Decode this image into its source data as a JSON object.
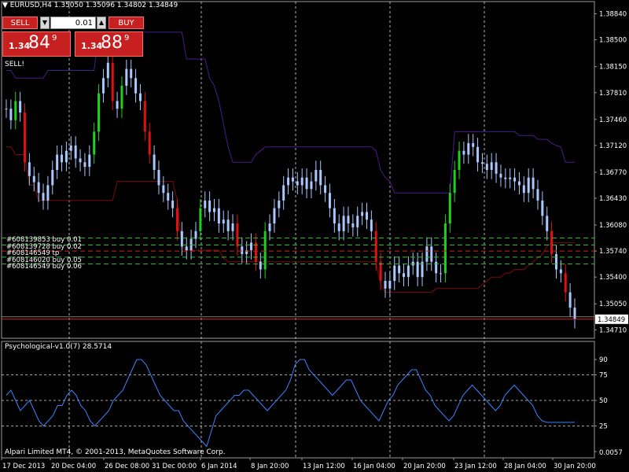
{
  "chart_header": {
    "symbol_line": "EURUSD,H4  1.35050 1.35096 1.34802 1.34849",
    "signal_text": "SELL!"
  },
  "one_click": {
    "sell_label": "SELL",
    "buy_label": "BUY",
    "lot_value": "0.01",
    "sell_prefix": "1.34",
    "sell_big": "84",
    "sell_super": "9",
    "buy_prefix": "1.34",
    "buy_big": "88",
    "buy_super": "9"
  },
  "orders": [
    "#608139853 buy 0.01",
    "#608139728 buy 0.02",
    "#608146549 tp",
    "#608146020 buy 0.05",
    "#608146549 buy 0.06"
  ],
  "current_price_label": "1.34849",
  "oscillator": {
    "title": "Psychological-v1.0(7) 28.5714",
    "levels": [
      "90",
      "75",
      "50",
      "25",
      "0.0057"
    ]
  },
  "copyright": "Alpari Limited MT4, © 2001-2013, MetaQuotes Software Corp.",
  "price_axis": [
    "1.38840",
    "1.38500",
    "1.38150",
    "1.37810",
    "1.37460",
    "1.37120",
    "1.36770",
    "1.36430",
    "1.36080",
    "1.35740",
    "1.35400",
    "1.35050",
    "1.34710"
  ],
  "time_axis": [
    "17 Dec 2013",
    "20 Dec 04:00",
    "26 Dec 08:00",
    "31 Dec 00:00",
    "6 Jan 2014",
    "8 Jan 20:00",
    "13 Jan 12:00",
    "16 Jan 04:00",
    "20 Jan 20:00",
    "23 Jan 12:00",
    "28 Jan 04:00",
    "30 Jan 20:00"
  ],
  "colors": {
    "bull_candle": "#1fd01f",
    "bear_candle": "#e01010",
    "neutral_bar": "#a8c8ff",
    "upper_channel": "#4b1a8c",
    "lower_channel": "#7a0c0c",
    "oscillator_line": "#3c82ff",
    "order_buy_line": "#3cbd3c",
    "order_tp_line": "#d02020",
    "sell_button": "#c62020"
  },
  "chart_data": {
    "type": "candlestick",
    "symbol": "EURUSD",
    "timeframe": "H4",
    "ohlc_current": {
      "open": 1.3505,
      "high": 1.35096,
      "low": 1.34802,
      "close": 1.34849
    },
    "ylim": [
      1.346,
      1.39
    ],
    "close_series": [
      1.376,
      1.3745,
      1.377,
      1.3755,
      1.369,
      1.3672,
      1.3664,
      1.365,
      1.364,
      1.366,
      1.368,
      1.37,
      1.369,
      1.3705,
      1.3712,
      1.3695,
      1.369,
      1.3684,
      1.37,
      1.373,
      1.378,
      1.38,
      1.382,
      1.377,
      1.376,
      1.379,
      1.3812,
      1.38,
      1.378,
      1.377,
      1.373,
      1.37,
      1.368,
      1.366,
      1.365,
      1.364,
      1.363,
      1.36,
      1.358,
      1.3575,
      1.359,
      1.36,
      1.363,
      1.364,
      1.3625,
      1.363,
      1.361,
      1.3615,
      1.36,
      1.361,
      1.358,
      1.357,
      1.3575,
      1.3585,
      1.356,
      1.355,
      1.36,
      1.361,
      1.363,
      1.364,
      1.366,
      1.367,
      1.3665,
      1.366,
      1.367,
      1.3655,
      1.3665,
      1.368,
      1.366,
      1.365,
      1.363,
      1.361,
      1.36,
      1.362,
      1.361,
      1.3605,
      1.362,
      1.3625,
      1.3615,
      1.36,
      1.356,
      1.3535,
      1.3525,
      1.3535,
      1.3555,
      1.3545,
      1.354,
      1.3555,
      1.356,
      1.354,
      1.356,
      1.358,
      1.356,
      1.3545,
      1.3545,
      1.361,
      1.365,
      1.368,
      1.3705,
      1.37,
      1.3715,
      1.371,
      1.369,
      1.3688,
      1.368,
      1.369,
      1.3675,
      1.367,
      1.3668,
      1.367,
      1.3665,
      1.366,
      1.365,
      1.367,
      1.3655,
      1.364,
      1.362,
      1.36,
      1.357,
      1.355,
      1.3545,
      1.352,
      1.35,
      1.3485
    ],
    "upper_channel": [
      1.381,
      1.381,
      1.38,
      1.38,
      1.38,
      1.38,
      1.38,
      1.38,
      1.38,
      1.381,
      1.381,
      1.381,
      1.381,
      1.381,
      1.381,
      1.381,
      1.381,
      1.381,
      1.381,
      1.381,
      1.386,
      1.386,
      1.386,
      1.386,
      1.386,
      1.386,
      1.386,
      1.386,
      1.386,
      1.386,
      1.386,
      1.386,
      1.386,
      1.386,
      1.386,
      1.386,
      1.386,
      1.386,
      1.386,
      1.3825,
      1.3825,
      1.3825,
      1.3825,
      1.3825,
      1.38,
      1.379,
      1.377,
      1.374,
      1.371,
      1.369,
      1.369,
      1.369,
      1.369,
      1.369,
      1.37,
      1.3705,
      1.371,
      1.371,
      1.371,
      1.371,
      1.371,
      1.371,
      1.371,
      1.371,
      1.371,
      1.371,
      1.371,
      1.371,
      1.371,
      1.371,
      1.371,
      1.371,
      1.371,
      1.371,
      1.371,
      1.371,
      1.371,
      1.371,
      1.371,
      1.371,
      1.3705,
      1.368,
      1.367,
      1.3665,
      1.365,
      1.365,
      1.365,
      1.365,
      1.365,
      1.365,
      1.365,
      1.365,
      1.365,
      1.365,
      1.365,
      1.365,
      1.365,
      1.373,
      1.373,
      1.373,
      1.373,
      1.373,
      1.373,
      1.373,
      1.373,
      1.373,
      1.373,
      1.373,
      1.373,
      1.373,
      1.373,
      1.3725,
      1.3725,
      1.3725,
      1.3725,
      1.372,
      1.372,
      1.372,
      1.3715,
      1.3712,
      1.371,
      1.369,
      1.369,
      1.369
    ],
    "lower_channel": [
      1.371,
      1.371,
      1.37,
      1.37,
      1.37,
      1.366,
      1.366,
      1.364,
      1.364,
      1.364,
      1.364,
      1.364,
      1.364,
      1.364,
      1.364,
      1.364,
      1.364,
      1.364,
      1.364,
      1.364,
      1.364,
      1.364,
      1.364,
      1.364,
      1.3665,
      1.3665,
      1.3665,
      1.3665,
      1.3665,
      1.3665,
      1.3665,
      1.3665,
      1.3665,
      1.3665,
      1.3665,
      1.3665,
      1.3665,
      1.364,
      1.358,
      1.3575,
      1.3575,
      1.3575,
      1.3575,
      1.3575,
      1.3575,
      1.3575,
      1.3575,
      1.3565,
      1.356,
      1.356,
      1.356,
      1.356,
      1.356,
      1.356,
      1.356,
      1.356,
      1.356,
      1.356,
      1.356,
      1.356,
      1.356,
      1.356,
      1.356,
      1.356,
      1.356,
      1.356,
      1.356,
      1.356,
      1.356,
      1.356,
      1.356,
      1.356,
      1.356,
      1.356,
      1.356,
      1.356,
      1.356,
      1.356,
      1.356,
      1.356,
      1.356,
      1.353,
      1.352,
      1.352,
      1.352,
      1.352,
      1.352,
      1.352,
      1.352,
      1.352,
      1.352,
      1.352,
      1.352,
      1.3525,
      1.3525,
      1.3525,
      1.3525,
      1.3525,
      1.3525,
      1.3525,
      1.3525,
      1.3525,
      1.3525,
      1.353,
      1.3535,
      1.354,
      1.354,
      1.354,
      1.3545,
      1.3545,
      1.355,
      1.355,
      1.355,
      1.3555,
      1.356,
      1.3565,
      1.357,
      1.358,
      1.3585,
      1.3585,
      1.3585,
      1.3585,
      1.3585,
      1.3585
    ],
    "orders": [
      {
        "label": "#608139853 buy 0.01",
        "price": 1.3591,
        "kind": "buy"
      },
      {
        "label": "#608139728 buy 0.02",
        "price": 1.3582,
        "kind": "buy"
      },
      {
        "label": "#608146549 tp",
        "price": 1.3574,
        "kind": "tp"
      },
      {
        "label": "#608146020 buy 0.05",
        "price": 1.3566,
        "kind": "buy"
      },
      {
        "label": "#608146549 buy 0.06",
        "price": 1.3557,
        "kind": "buy"
      }
    ],
    "current_price": 1.34849,
    "oscillator_values": [
      55,
      60,
      50,
      40,
      45,
      50,
      40,
      30,
      25,
      30,
      35,
      45,
      45,
      55,
      60,
      55,
      45,
      40,
      30,
      25,
      30,
      35,
      40,
      50,
      55,
      60,
      70,
      80,
      90,
      90,
      85,
      75,
      65,
      55,
      50,
      45,
      40,
      40,
      30,
      25,
      20,
      15,
      10,
      5,
      20,
      35,
      40,
      45,
      50,
      55,
      55,
      60,
      60,
      55,
      50,
      45,
      40,
      45,
      50,
      55,
      60,
      70,
      85,
      90,
      90,
      80,
      75,
      70,
      65,
      60,
      55,
      60,
      65,
      70,
      70,
      60,
      50,
      45,
      40,
      35,
      30,
      40,
      50,
      55,
      65,
      70,
      75,
      80,
      80,
      70,
      60,
      55,
      45,
      40,
      35,
      30,
      35,
      45,
      55,
      60,
      65,
      60,
      55,
      50,
      45,
      40,
      45,
      55,
      60,
      65,
      60,
      55,
      50,
      45,
      35,
      30,
      28.5714,
      28.5714,
      28.5714,
      28.5714,
      28.5714,
      28.5714,
      28.5714
    ]
  }
}
